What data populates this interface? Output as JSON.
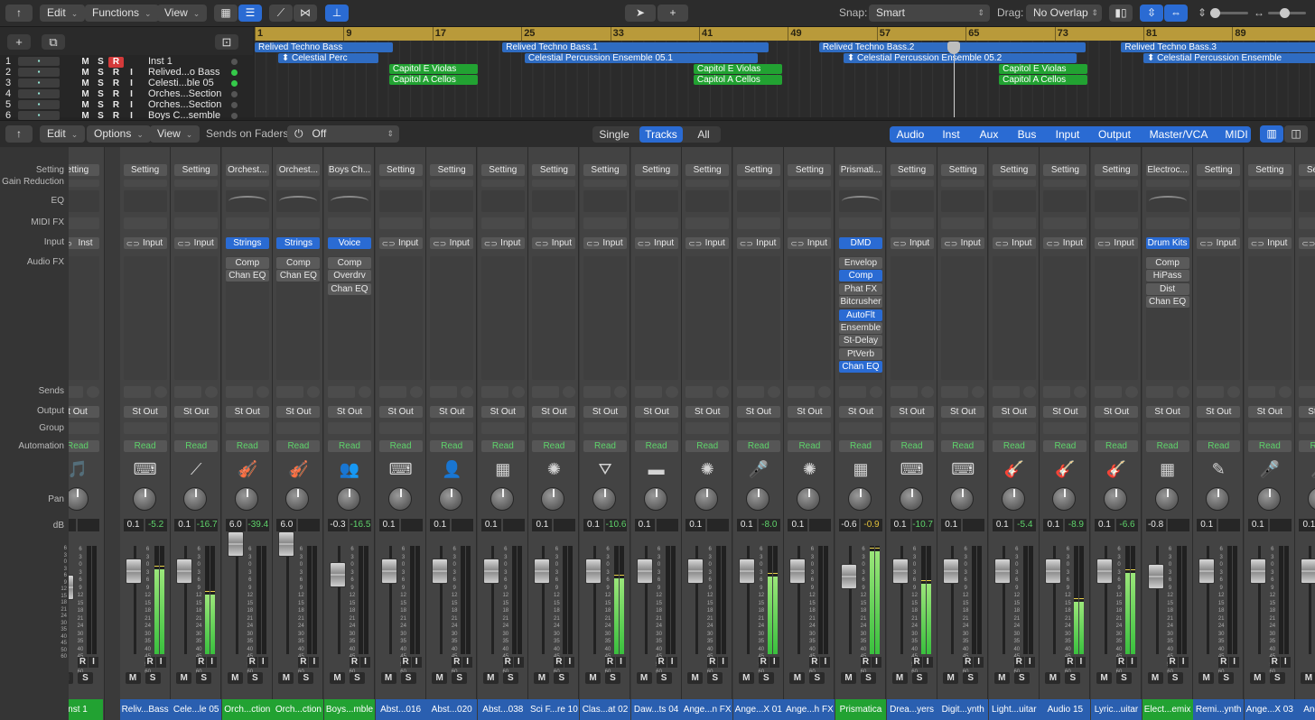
{
  "toolbar": {
    "edit": "Edit",
    "functions": "Functions",
    "view": "View",
    "snap_label": "Snap:",
    "snap_value": "Smart",
    "drag_label": "Drag:",
    "drag_value": "No Overlap"
  },
  "ruler": {
    "bars": [
      "1",
      "9",
      "17",
      "25",
      "33",
      "41",
      "49",
      "57",
      "65",
      "73",
      "81",
      "89"
    ]
  },
  "tracks": [
    {
      "num": "1",
      "name": "Inst 1",
      "rec": true,
      "dot": "gray"
    },
    {
      "num": "2",
      "name": "Relived...o Bass",
      "rec": false,
      "dot": "green"
    },
    {
      "num": "3",
      "name": "Celesti...ble 05",
      "rec": false,
      "dot": "green"
    },
    {
      "num": "4",
      "name": "Orches...Section",
      "rec": false,
      "dot": "gray"
    },
    {
      "num": "5",
      "name": "Orches...Section",
      "rec": false,
      "dot": "gray"
    },
    {
      "num": "6",
      "name": "Boys C...semble",
      "rec": false,
      "dot": "gray"
    }
  ],
  "regions": [
    {
      "label": "Relived Techno Bass",
      "color": "blue",
      "row": 0,
      "bar": 1,
      "len": 12.4
    },
    {
      "label": "Relived Techno Bass.1",
      "color": "blue",
      "row": 0,
      "bar": 23.3,
      "len": 24
    },
    {
      "label": "Relived Techno Bass.2",
      "color": "blue",
      "row": 0,
      "bar": 51.8,
      "len": 24
    },
    {
      "label": "Relived Techno Bass.3",
      "color": "blue",
      "row": 0,
      "bar": 79,
      "len": 24
    },
    {
      "label": "⬍ Celestial Perc",
      "color": "blue",
      "row": 1,
      "bar": 3.1,
      "len": 9
    },
    {
      "label": "Celestial Percussion Ensemble 05.1",
      "color": "blue",
      "row": 1,
      "bar": 25.3,
      "len": 21
    },
    {
      "label": "⬍ Celestial Percussion Ensemble 05.2",
      "color": "blue",
      "row": 1,
      "bar": 54,
      "len": 21
    },
    {
      "label": "⬍ Celestial Percussion Ensemble",
      "color": "blue",
      "row": 1,
      "bar": 81,
      "len": 21
    },
    {
      "label": "Capitol E Violas",
      "color": "green",
      "row": 2,
      "bar": 13.1,
      "len": 8
    },
    {
      "label": "Capitol E Violas",
      "color": "green",
      "row": 2,
      "bar": 40.5,
      "len": 8
    },
    {
      "label": "Capitol E Violas",
      "color": "green",
      "row": 2,
      "bar": 68,
      "len": 8
    },
    {
      "label": "Capitol A Cellos",
      "color": "green",
      "row": 3,
      "bar": 13.1,
      "len": 8
    },
    {
      "label": "Capitol A Cellos",
      "color": "green",
      "row": 3,
      "bar": 40.5,
      "len": 8
    },
    {
      "label": "Capitol A Cellos",
      "color": "green",
      "row": 3,
      "bar": 68,
      "len": 8
    }
  ],
  "mixbar": {
    "edit": "Edit",
    "options": "Options",
    "view": "View",
    "sends_label": "Sends on Faders:",
    "sends_value": "Off",
    "filters": [
      "Single",
      "Tracks",
      "All"
    ],
    "filter_on": "Tracks",
    "types": [
      "Audio",
      "Inst",
      "Aux",
      "Bus",
      "Input",
      "Output",
      "Master/VCA",
      "MIDI"
    ]
  },
  "rowlabels": [
    {
      "t": "Setting"
    },
    {
      "t": "Gain Reduction"
    },
    {
      "t": "EQ"
    },
    {
      "t": "MIDI FX"
    },
    {
      "t": "Input"
    },
    {
      "t": "Audio FX"
    },
    {
      "t": "Sends"
    },
    {
      "t": "Output"
    },
    {
      "t": "Group"
    },
    {
      "t": "Automation"
    },
    {
      "t": "Pan"
    },
    {
      "t": "dB"
    }
  ],
  "strips": [
    {
      "setting": "etting",
      "input": "Inst",
      "inst": false,
      "fx": [],
      "output": "t Out",
      "auto": "Read",
      "icon": "🎵",
      "db1": "0",
      "db2": "",
      "dbc": "g",
      "fader": 0.3,
      "meter": 0,
      "name": "nst 1",
      "color": "green"
    },
    {
      "setting": "Setting",
      "input": "Input",
      "inst": false,
      "fx": [],
      "output": "St Out",
      "auto": "Read",
      "icon": "⌨",
      "db1": "0.1",
      "db2": "-5.2",
      "dbc": "g",
      "fader": 0.15,
      "meter": 0.78,
      "name": "Reliv...Bass",
      "color": "blue"
    },
    {
      "setting": "Setting",
      "input": "Input",
      "inst": false,
      "fx": [],
      "output": "St Out",
      "auto": "Read",
      "icon": "⟋",
      "db1": "0.1",
      "db2": "-16.7",
      "dbc": "g",
      "fader": 0.15,
      "meter": 0.55,
      "name": "Cele...le 05",
      "color": "blue"
    },
    {
      "setting": "Orchest...",
      "input": "Strings",
      "inst": true,
      "fx": [
        "Comp",
        "Chan EQ"
      ],
      "output": "St Out",
      "auto": "Read",
      "icon": "🎻",
      "db1": "6.0",
      "db2": "-39.4",
      "dbc": "g",
      "fader": -0.1,
      "meter": 0,
      "name": "Orch...ction",
      "color": "green"
    },
    {
      "setting": "Orchest...",
      "input": "Strings",
      "inst": true,
      "fx": [
        "Comp",
        "Chan EQ"
      ],
      "output": "St Out",
      "auto": "Read",
      "icon": "🎻",
      "db1": "6.0",
      "db2": "",
      "dbc": "g",
      "fader": -0.1,
      "meter": 0,
      "name": "Orch...ction",
      "color": "green"
    },
    {
      "setting": "Boys Ch...",
      "input": "Voice",
      "inst": true,
      "fx": [
        "Comp",
        "Overdrv",
        "Chan EQ"
      ],
      "output": "St Out",
      "auto": "Read",
      "icon": "👥",
      "db1": "-0.3",
      "db2": "-16.5",
      "dbc": "g",
      "fader": 0.18,
      "meter": 0,
      "name": "Boys...mble",
      "color": "green"
    },
    {
      "setting": "Setting",
      "input": "Input",
      "inst": false,
      "fx": [],
      "output": "St Out",
      "auto": "Read",
      "icon": "⌨",
      "db1": "0.1",
      "db2": "",
      "dbc": "g",
      "fader": 0.15,
      "meter": 0,
      "name": "Abst...016",
      "color": "blue"
    },
    {
      "setting": "Setting",
      "input": "Input",
      "inst": false,
      "fx": [],
      "output": "St Out",
      "auto": "Read",
      "icon": "👤",
      "db1": "0.1",
      "db2": "",
      "dbc": "g",
      "fader": 0.15,
      "meter": 0,
      "name": "Abst...020",
      "color": "blue"
    },
    {
      "setting": "Setting",
      "input": "Input",
      "inst": false,
      "fx": [],
      "output": "St Out",
      "auto": "Read",
      "icon": "▦",
      "db1": "0.1",
      "db2": "",
      "dbc": "g",
      "fader": 0.15,
      "meter": 0,
      "name": "Abst...038",
      "color": "blue"
    },
    {
      "setting": "Setting",
      "input": "Input",
      "inst": false,
      "fx": [],
      "output": "St Out",
      "auto": "Read",
      "icon": "✺",
      "db1": "0.1",
      "db2": "",
      "dbc": "g",
      "fader": 0.15,
      "meter": 0,
      "name": "Sci F...re 10",
      "color": "blue"
    },
    {
      "setting": "Setting",
      "input": "Input",
      "inst": false,
      "fx": [],
      "output": "St Out",
      "auto": "Read",
      "icon": "⛛",
      "db1": "0.1",
      "db2": "-10.6",
      "dbc": "g",
      "fader": 0.15,
      "meter": 0.7,
      "name": "Clas...at 02",
      "color": "blue"
    },
    {
      "setting": "Setting",
      "input": "Input",
      "inst": false,
      "fx": [],
      "output": "St Out",
      "auto": "Read",
      "icon": "▬",
      "db1": "0.1",
      "db2": "",
      "dbc": "g",
      "fader": 0.15,
      "meter": 0,
      "name": "Daw...ts 04",
      "color": "blue"
    },
    {
      "setting": "Setting",
      "input": "Input",
      "inst": false,
      "fx": [],
      "output": "St Out",
      "auto": "Read",
      "icon": "✺",
      "db1": "0.1",
      "db2": "",
      "dbc": "g",
      "fader": 0.15,
      "meter": 0,
      "name": "Ange...n FX",
      "color": "blue"
    },
    {
      "setting": "Setting",
      "input": "Input",
      "inst": false,
      "fx": [],
      "output": "St Out",
      "auto": "Read",
      "icon": "🎤",
      "db1": "0.1",
      "db2": "-8.0",
      "dbc": "g",
      "fader": 0.15,
      "meter": 0.72,
      "name": "Ange...X 01",
      "color": "blue"
    },
    {
      "setting": "Setting",
      "input": "Input",
      "inst": false,
      "fx": [],
      "output": "St Out",
      "auto": "Read",
      "icon": "✺",
      "db1": "0.1",
      "db2": "",
      "dbc": "g",
      "fader": 0.15,
      "meter": 0,
      "name": "Ange...h FX",
      "color": "blue"
    },
    {
      "setting": "Prismati...",
      "input": "DMD",
      "inst": true,
      "fx": [
        {
          "t": "Envelop",
          "on": false
        },
        {
          "t": "Comp",
          "on": true
        },
        {
          "t": "Phat FX",
          "on": false
        },
        {
          "t": "Bitcrusher",
          "on": false
        },
        {
          "t": "AutoFlt",
          "on": true
        },
        {
          "t": "Ensemble",
          "on": false
        },
        {
          "t": "St-Delay",
          "on": false
        },
        {
          "t": "PtVerb",
          "on": false
        },
        {
          "t": "Chan EQ",
          "on": true
        }
      ],
      "output": "St Out",
      "auto": "Read",
      "icon": "▦",
      "db1": "-0.6",
      "db2": "-0.9",
      "dbc": "y",
      "fader": 0.2,
      "meter": 0.95,
      "name": "Prismatica",
      "color": "green"
    },
    {
      "setting": "Setting",
      "input": "Input",
      "inst": false,
      "fx": [],
      "output": "St Out",
      "auto": "Read",
      "icon": "⌨",
      "db1": "0.1",
      "db2": "-10.7",
      "dbc": "g",
      "fader": 0.15,
      "meter": 0.65,
      "name": "Drea...yers",
      "color": "blue"
    },
    {
      "setting": "Setting",
      "input": "Input",
      "inst": false,
      "fx": [],
      "output": "St Out",
      "auto": "Read",
      "icon": "⌨",
      "db1": "0.1",
      "db2": "",
      "dbc": "g",
      "fader": 0.15,
      "meter": 0,
      "name": "Digit...ynth",
      "color": "blue"
    },
    {
      "setting": "Setting",
      "input": "Input",
      "inst": false,
      "fx": [],
      "output": "St Out",
      "auto": "Read",
      "icon": "🎸",
      "db1": "0.1",
      "db2": "-5.4",
      "dbc": "g",
      "fader": 0.15,
      "meter": 0,
      "name": "Light...uitar",
      "color": "blue"
    },
    {
      "setting": "Setting",
      "input": "Input",
      "inst": false,
      "fx": [],
      "output": "St Out",
      "auto": "Read",
      "icon": "🎸",
      "db1": "0.1",
      "db2": "-8.9",
      "dbc": "g",
      "fader": 0.15,
      "meter": 0.48,
      "name": "Audio 15",
      "color": "blue"
    },
    {
      "setting": "Setting",
      "input": "Input",
      "inst": false,
      "fx": [],
      "output": "St Out",
      "auto": "Read",
      "icon": "🎸",
      "db1": "0.1",
      "db2": "-6.6",
      "dbc": "g",
      "fader": 0.15,
      "meter": 0.75,
      "name": "Lyric...uitar",
      "color": "blue"
    },
    {
      "setting": "Electroc...",
      "input": "Drum Kits",
      "inst": true,
      "fx": [
        "Comp",
        "HiPass",
        "Dist",
        "Chan EQ"
      ],
      "output": "St Out",
      "auto": "Read",
      "icon": "▦",
      "db1": "-0.8",
      "db2": "",
      "dbc": "g",
      "fader": 0.2,
      "meter": 0,
      "name": "Elect...emix",
      "color": "green"
    },
    {
      "setting": "Setting",
      "input": "Input",
      "inst": false,
      "fx": [],
      "output": "St Out",
      "auto": "Read",
      "icon": "✎",
      "db1": "0.1",
      "db2": "",
      "dbc": "g",
      "fader": 0.15,
      "meter": 0,
      "name": "Remi...ynth",
      "color": "blue"
    },
    {
      "setting": "Setting",
      "input": "Input",
      "inst": false,
      "fx": [],
      "output": "St Out",
      "auto": "Read",
      "icon": "🎤",
      "db1": "0.1",
      "db2": "",
      "dbc": "g",
      "fader": 0.15,
      "meter": 0,
      "name": "Ange...X 03",
      "color": "blue"
    },
    {
      "setting": "Setting",
      "input": "Input",
      "inst": false,
      "fx": [],
      "output": "St Out",
      "auto": "Read",
      "icon": "🎤",
      "db1": "0.1",
      "db2": "",
      "dbc": "g",
      "fader": 0.15,
      "meter": 0,
      "name": "Ange...X",
      "color": "blue"
    }
  ],
  "scale": [
    "6",
    "3",
    "0",
    "3",
    "6",
    "9",
    "12",
    "15",
    "18",
    "21",
    "24",
    "30",
    "35",
    "40",
    "45",
    "50",
    "60"
  ],
  "strip_labels": {
    "ri_r": "R",
    "ri_i": "I",
    "ms_m": "M",
    "ms_s": "S",
    "track_m": "M",
    "track_s": "S",
    "track_r": "R",
    "track_i": "I"
  }
}
